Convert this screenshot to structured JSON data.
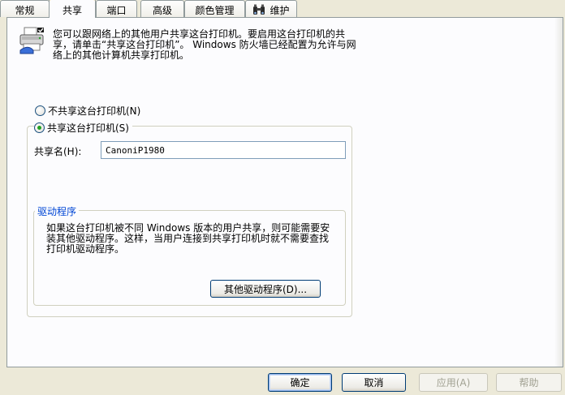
{
  "tabs": [
    {
      "label": "常规"
    },
    {
      "label": "共享",
      "active": true
    },
    {
      "label": "端口"
    },
    {
      "label": "高级"
    },
    {
      "label": "颜色管理"
    },
    {
      "label": "维护",
      "icon": "binoculars-icon"
    }
  ],
  "sharing": {
    "description": "您可以跟网络上的其他用户共享这台打印机。要启用这台打印机的共享，请单击“共享这台打印机”。 Windows 防火墙已经配置为允许与网络上的其他计算机共享打印机。",
    "no_share_label": "不共享这台打印机(N)",
    "share_label": "共享这台打印机(S)",
    "selected": "share",
    "share_name_label": "共享名(H):",
    "share_name_value": "CanoniP1980"
  },
  "drivers": {
    "group_title": "驱动程序",
    "description": "如果这台打印机被不同 Windows 版本的用户共享，则可能需要安装其他驱动程序。这样，当用户连接到共享打印机时就不需要查找打印机驱动程序。",
    "additional_drivers_button": "其他驱动程序(D)..."
  },
  "footer": {
    "ok": "确定",
    "cancel": "取消",
    "apply": "应用(A)",
    "help": "帮助"
  },
  "colors": {
    "accent_tab": "#ffc83c",
    "radio_check": "#21a121",
    "group_title": "#0046d5",
    "dialog_bg": "#ece9d8"
  }
}
